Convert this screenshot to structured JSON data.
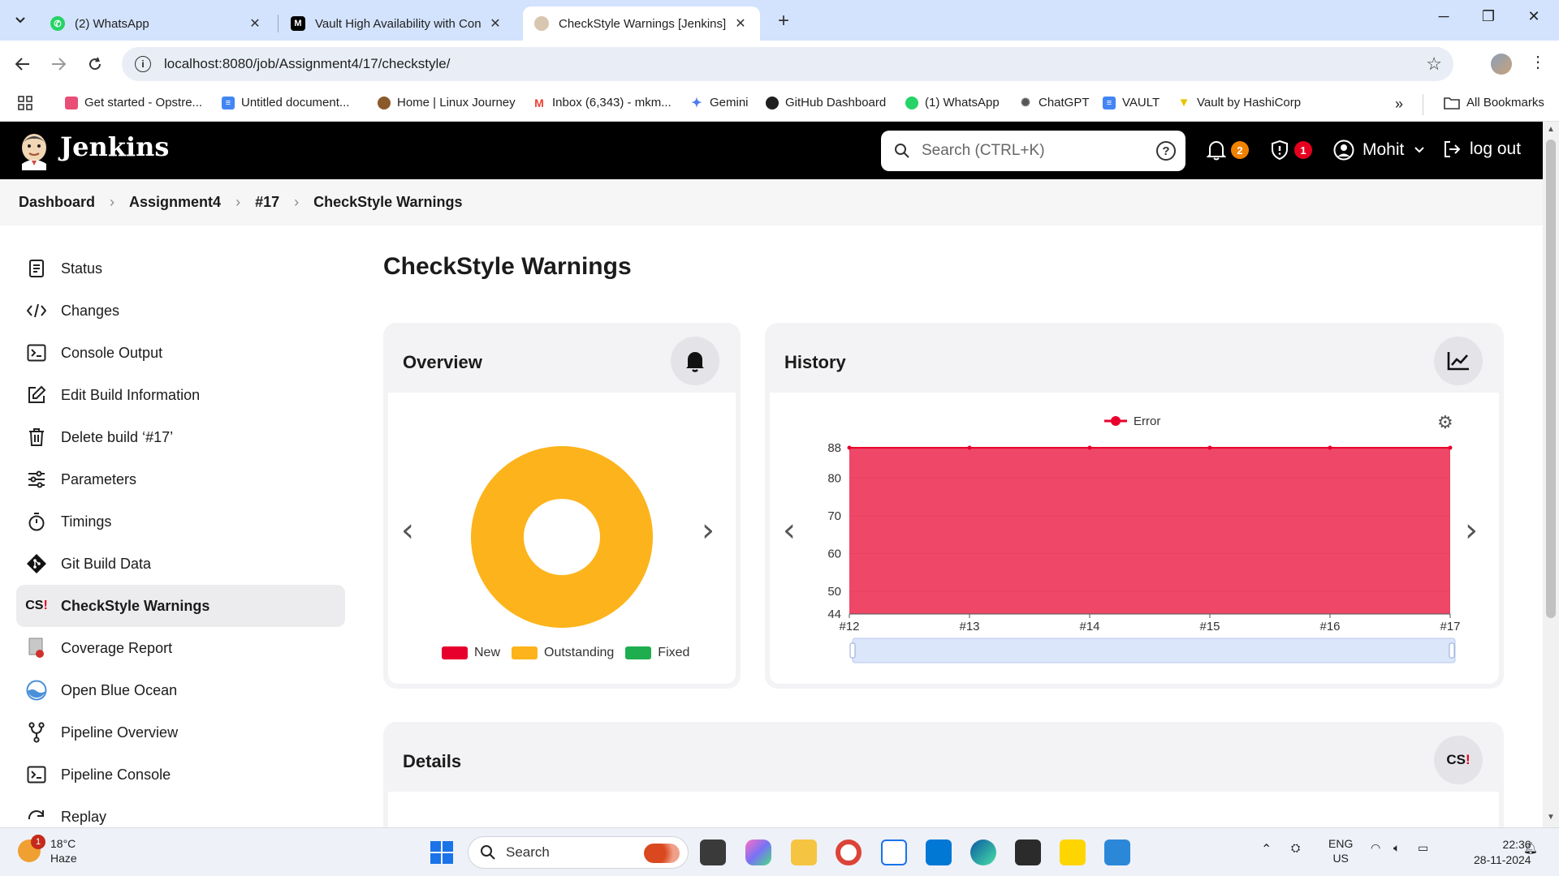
{
  "browser": {
    "tabs": [
      {
        "title": "(2) WhatsApp",
        "favicon": "whatsapp-icon",
        "active": false
      },
      {
        "title": "Vault High Availability with Con",
        "favicon": "medium-icon",
        "active": false
      },
      {
        "title": "CheckStyle Warnings [Jenkins]",
        "favicon": "jenkins-icon",
        "active": true
      }
    ],
    "url": "localhost:8080/job/Assignment4/17/checkstyle/",
    "bookmarks": [
      {
        "label": "Get started - Opstre...",
        "icon": "opstree-icon",
        "color": "#e94e77"
      },
      {
        "label": "Untitled document...",
        "icon": "docs-icon",
        "color": "#4285f4"
      },
      {
        "label": "Home | Linux Journey",
        "icon": "linux-journey-icon",
        "color": "#8a5a2b"
      },
      {
        "label": "Inbox (6,343) - mkm...",
        "icon": "gmail-icon",
        "color": "#ea4335"
      },
      {
        "label": "Gemini",
        "icon": "gemini-icon",
        "color": "#4c7df0"
      },
      {
        "label": "GitHub Dashboard",
        "icon": "github-icon",
        "color": "#1f1f1f"
      },
      {
        "label": "(1) WhatsApp",
        "icon": "whatsapp-icon",
        "color": "#25d366"
      },
      {
        "label": "ChatGPT",
        "icon": "chatgpt-icon",
        "color": "#555555"
      },
      {
        "label": "VAULT",
        "icon": "docs-icon",
        "color": "#4285f4"
      },
      {
        "label": "Vault by HashiCorp",
        "icon": "vault-icon",
        "color": "#ffd814"
      }
    ],
    "all_bookmarks": "All Bookmarks"
  },
  "jenkins": {
    "brand": "Jenkins",
    "search_placeholder": "Search (CTRL+K)",
    "notifications_count": "2",
    "security_count": "1",
    "user": "Mohit",
    "logout": "log out"
  },
  "breadcrumb": [
    "Dashboard",
    "Assignment4",
    "#17",
    "CheckStyle Warnings"
  ],
  "sidebar": [
    {
      "label": "Status",
      "icon": "status-icon"
    },
    {
      "label": "Changes",
      "icon": "code-icon"
    },
    {
      "label": "Console Output",
      "icon": "terminal-icon"
    },
    {
      "label": "Edit Build Information",
      "icon": "edit-icon"
    },
    {
      "label": "Delete build ‘#17’",
      "icon": "trash-icon"
    },
    {
      "label": "Parameters",
      "icon": "sliders-icon"
    },
    {
      "label": "Timings",
      "icon": "stopwatch-icon"
    },
    {
      "label": "Git Build Data",
      "icon": "git-icon"
    },
    {
      "label": "CheckStyle Warnings",
      "icon": "checkstyle-icon",
      "active": true
    },
    {
      "label": "Coverage Report",
      "icon": "coverage-icon"
    },
    {
      "label": "Open Blue Ocean",
      "icon": "blue-ocean-icon"
    },
    {
      "label": "Pipeline Overview",
      "icon": "pipeline-icon"
    },
    {
      "label": "Pipeline Console",
      "icon": "terminal-icon"
    },
    {
      "label": "Replay",
      "icon": "replay-icon"
    }
  ],
  "main": {
    "title": "CheckStyle Warnings",
    "overview": {
      "title": "Overview",
      "legend": [
        {
          "label": "New",
          "color": "#e8002d"
        },
        {
          "label": "Outstanding",
          "color": "#fdb31b"
        },
        {
          "label": "Fixed",
          "color": "#1eae4e"
        }
      ]
    },
    "history": {
      "title": "History"
    },
    "details": {
      "title": "Details",
      "icon_label": "CS"
    }
  },
  "chart_data": [
    {
      "type": "pie",
      "subtype": "donut",
      "labels": [
        "New",
        "Outstanding",
        "Fixed"
      ],
      "values": [
        0,
        88,
        0
      ],
      "colors": [
        "#e8002d",
        "#fdb31b",
        "#1eae4e"
      ],
      "legend": "bottom"
    },
    {
      "type": "area",
      "categories": [
        "#12",
        "#13",
        "#14",
        "#15",
        "#16",
        "#17"
      ],
      "series": [
        {
          "name": "Error",
          "values": [
            88,
            88,
            88,
            88,
            88,
            88
          ],
          "color": "#e8002d"
        }
      ],
      "ylim": [
        44,
        88
      ],
      "yticks": [
        44,
        50,
        60,
        70,
        80,
        88
      ],
      "legend": "top",
      "grid": true
    }
  ],
  "taskbar": {
    "weather_temp": "18°C",
    "weather_desc": "Haze",
    "weather_badge": "1",
    "search": "Search",
    "lang_top": "ENG",
    "lang_bottom": "US",
    "time": "22:36",
    "date": "28-11-2024"
  }
}
